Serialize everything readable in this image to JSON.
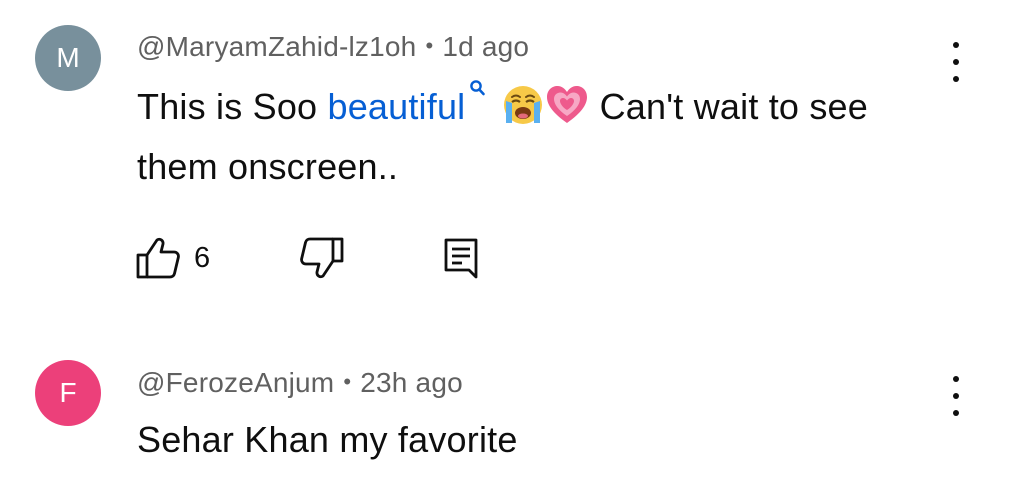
{
  "comments": [
    {
      "avatar_letter": "M",
      "avatar_color": "#78909c",
      "author": "@MaryamZahid-lz1oh",
      "separator": "•",
      "time": "1d ago",
      "text_before_link": "This is Soo ",
      "link_text": "beautiful",
      "emojis": [
        "loudly-crying-face",
        "growing-heart"
      ],
      "text_after_emoji": " Can't wait to see",
      "text_line2": "them onscreen..",
      "like_count": "6",
      "menu_icon": "kebab-menu-icon"
    },
    {
      "avatar_letter": "F",
      "avatar_color": "#ec407a",
      "author": "@FerozeAnjum",
      "separator": "•",
      "time": "23h ago",
      "text": "Sehar Khan my favorite",
      "menu_icon": "kebab-menu-icon"
    }
  ],
  "colors": {
    "link": "#065fd4",
    "meta_text": "#606060",
    "body_text": "#0f0f0f"
  }
}
